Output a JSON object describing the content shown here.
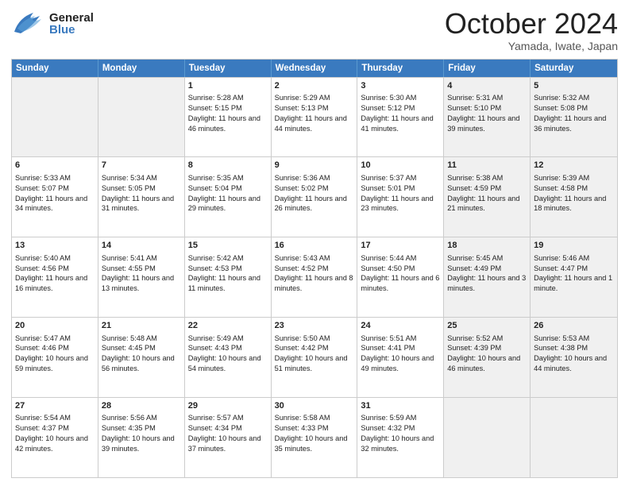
{
  "header": {
    "logo_general": "General",
    "logo_blue": "Blue",
    "month_title": "October 2024",
    "location": "Yamada, Iwate, Japan"
  },
  "days_of_week": [
    "Sunday",
    "Monday",
    "Tuesday",
    "Wednesday",
    "Thursday",
    "Friday",
    "Saturday"
  ],
  "weeks": [
    [
      {
        "day": "",
        "info": "",
        "shaded": true
      },
      {
        "day": "",
        "info": "",
        "shaded": true
      },
      {
        "day": "1",
        "info": "Sunrise: 5:28 AM\nSunset: 5:15 PM\nDaylight: 11 hours and 46 minutes.",
        "shaded": false
      },
      {
        "day": "2",
        "info": "Sunrise: 5:29 AM\nSunset: 5:13 PM\nDaylight: 11 hours and 44 minutes.",
        "shaded": false
      },
      {
        "day": "3",
        "info": "Sunrise: 5:30 AM\nSunset: 5:12 PM\nDaylight: 11 hours and 41 minutes.",
        "shaded": false
      },
      {
        "day": "4",
        "info": "Sunrise: 5:31 AM\nSunset: 5:10 PM\nDaylight: 11 hours and 39 minutes.",
        "shaded": true
      },
      {
        "day": "5",
        "info": "Sunrise: 5:32 AM\nSunset: 5:08 PM\nDaylight: 11 hours and 36 minutes.",
        "shaded": true
      }
    ],
    [
      {
        "day": "6",
        "info": "Sunrise: 5:33 AM\nSunset: 5:07 PM\nDaylight: 11 hours and 34 minutes.",
        "shaded": false
      },
      {
        "day": "7",
        "info": "Sunrise: 5:34 AM\nSunset: 5:05 PM\nDaylight: 11 hours and 31 minutes.",
        "shaded": false
      },
      {
        "day": "8",
        "info": "Sunrise: 5:35 AM\nSunset: 5:04 PM\nDaylight: 11 hours and 29 minutes.",
        "shaded": false
      },
      {
        "day": "9",
        "info": "Sunrise: 5:36 AM\nSunset: 5:02 PM\nDaylight: 11 hours and 26 minutes.",
        "shaded": false
      },
      {
        "day": "10",
        "info": "Sunrise: 5:37 AM\nSunset: 5:01 PM\nDaylight: 11 hours and 23 minutes.",
        "shaded": false
      },
      {
        "day": "11",
        "info": "Sunrise: 5:38 AM\nSunset: 4:59 PM\nDaylight: 11 hours and 21 minutes.",
        "shaded": true
      },
      {
        "day": "12",
        "info": "Sunrise: 5:39 AM\nSunset: 4:58 PM\nDaylight: 11 hours and 18 minutes.",
        "shaded": true
      }
    ],
    [
      {
        "day": "13",
        "info": "Sunrise: 5:40 AM\nSunset: 4:56 PM\nDaylight: 11 hours and 16 minutes.",
        "shaded": false
      },
      {
        "day": "14",
        "info": "Sunrise: 5:41 AM\nSunset: 4:55 PM\nDaylight: 11 hours and 13 minutes.",
        "shaded": false
      },
      {
        "day": "15",
        "info": "Sunrise: 5:42 AM\nSunset: 4:53 PM\nDaylight: 11 hours and 11 minutes.",
        "shaded": false
      },
      {
        "day": "16",
        "info": "Sunrise: 5:43 AM\nSunset: 4:52 PM\nDaylight: 11 hours and 8 minutes.",
        "shaded": false
      },
      {
        "day": "17",
        "info": "Sunrise: 5:44 AM\nSunset: 4:50 PM\nDaylight: 11 hours and 6 minutes.",
        "shaded": false
      },
      {
        "day": "18",
        "info": "Sunrise: 5:45 AM\nSunset: 4:49 PM\nDaylight: 11 hours and 3 minutes.",
        "shaded": true
      },
      {
        "day": "19",
        "info": "Sunrise: 5:46 AM\nSunset: 4:47 PM\nDaylight: 11 hours and 1 minute.",
        "shaded": true
      }
    ],
    [
      {
        "day": "20",
        "info": "Sunrise: 5:47 AM\nSunset: 4:46 PM\nDaylight: 10 hours and 59 minutes.",
        "shaded": false
      },
      {
        "day": "21",
        "info": "Sunrise: 5:48 AM\nSunset: 4:45 PM\nDaylight: 10 hours and 56 minutes.",
        "shaded": false
      },
      {
        "day": "22",
        "info": "Sunrise: 5:49 AM\nSunset: 4:43 PM\nDaylight: 10 hours and 54 minutes.",
        "shaded": false
      },
      {
        "day": "23",
        "info": "Sunrise: 5:50 AM\nSunset: 4:42 PM\nDaylight: 10 hours and 51 minutes.",
        "shaded": false
      },
      {
        "day": "24",
        "info": "Sunrise: 5:51 AM\nSunset: 4:41 PM\nDaylight: 10 hours and 49 minutes.",
        "shaded": false
      },
      {
        "day": "25",
        "info": "Sunrise: 5:52 AM\nSunset: 4:39 PM\nDaylight: 10 hours and 46 minutes.",
        "shaded": true
      },
      {
        "day": "26",
        "info": "Sunrise: 5:53 AM\nSunset: 4:38 PM\nDaylight: 10 hours and 44 minutes.",
        "shaded": true
      }
    ],
    [
      {
        "day": "27",
        "info": "Sunrise: 5:54 AM\nSunset: 4:37 PM\nDaylight: 10 hours and 42 minutes.",
        "shaded": false
      },
      {
        "day": "28",
        "info": "Sunrise: 5:56 AM\nSunset: 4:35 PM\nDaylight: 10 hours and 39 minutes.",
        "shaded": false
      },
      {
        "day": "29",
        "info": "Sunrise: 5:57 AM\nSunset: 4:34 PM\nDaylight: 10 hours and 37 minutes.",
        "shaded": false
      },
      {
        "day": "30",
        "info": "Sunrise: 5:58 AM\nSunset: 4:33 PM\nDaylight: 10 hours and 35 minutes.",
        "shaded": false
      },
      {
        "day": "31",
        "info": "Sunrise: 5:59 AM\nSunset: 4:32 PM\nDaylight: 10 hours and 32 minutes.",
        "shaded": false
      },
      {
        "day": "",
        "info": "",
        "shaded": true
      },
      {
        "day": "",
        "info": "",
        "shaded": true
      }
    ]
  ]
}
